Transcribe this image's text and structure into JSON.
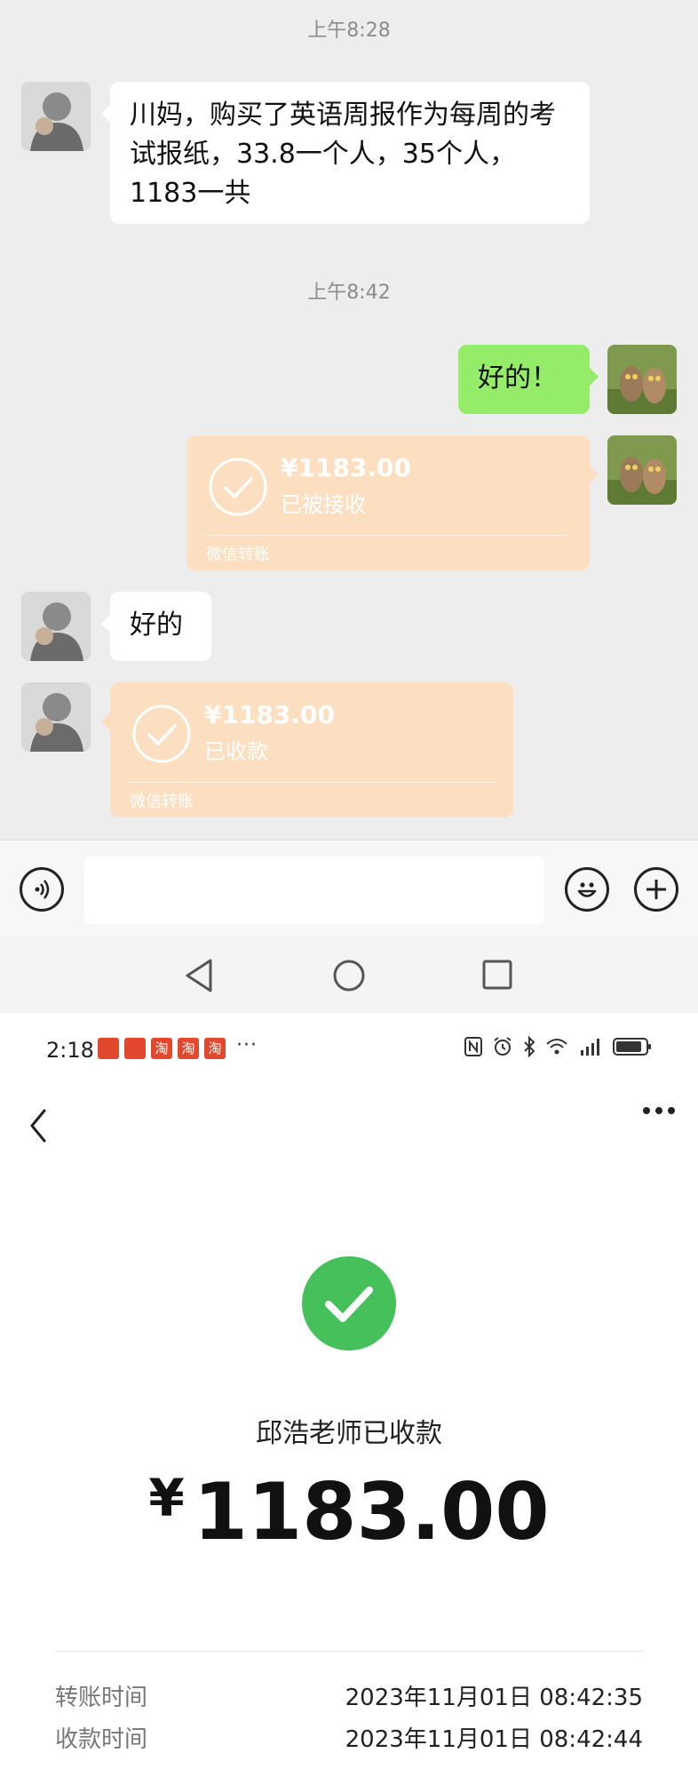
{
  "chat": {
    "timestamp_1": "上午8:28",
    "msg_1": "川妈，购买了英语周报作为每周的考试报纸，33.8一个人，35个人，1183一共",
    "timestamp_2": "上午8:42",
    "msg_2": "好的！",
    "transfer_out": {
      "amount": "¥1183.00",
      "status": "已被接收",
      "brand": "微信转账"
    },
    "msg_3": "好的",
    "transfer_in": {
      "amount": "¥1183.00",
      "status": "已收款",
      "brand": "微信转账"
    }
  },
  "statusbar": {
    "time": "2:18",
    "app_glyphs": [
      "",
      "",
      "淘",
      "淘",
      "淘"
    ],
    "dots": "···"
  },
  "receipt": {
    "receiver": "邱浩老师已收款",
    "currency": "¥",
    "amount": "1183.00",
    "rows": [
      {
        "label": "转账时间",
        "value": "2023年11月01日 08:42:35"
      },
      {
        "label": "收款时间",
        "value": "2023年11月01日 08:42:44"
      }
    ]
  },
  "colors": {
    "chat_bg": "#ededed",
    "green_bubble": "#95ec69",
    "transfer_bg": "#fbdfc0",
    "success_green": "#46c05b"
  },
  "icons": [
    "voice-icon",
    "emoji-icon",
    "plus-icon",
    "back-triangle-icon",
    "home-circle-icon",
    "recents-square-icon",
    "back-arrow-icon",
    "more-icon",
    "check-icon"
  ]
}
